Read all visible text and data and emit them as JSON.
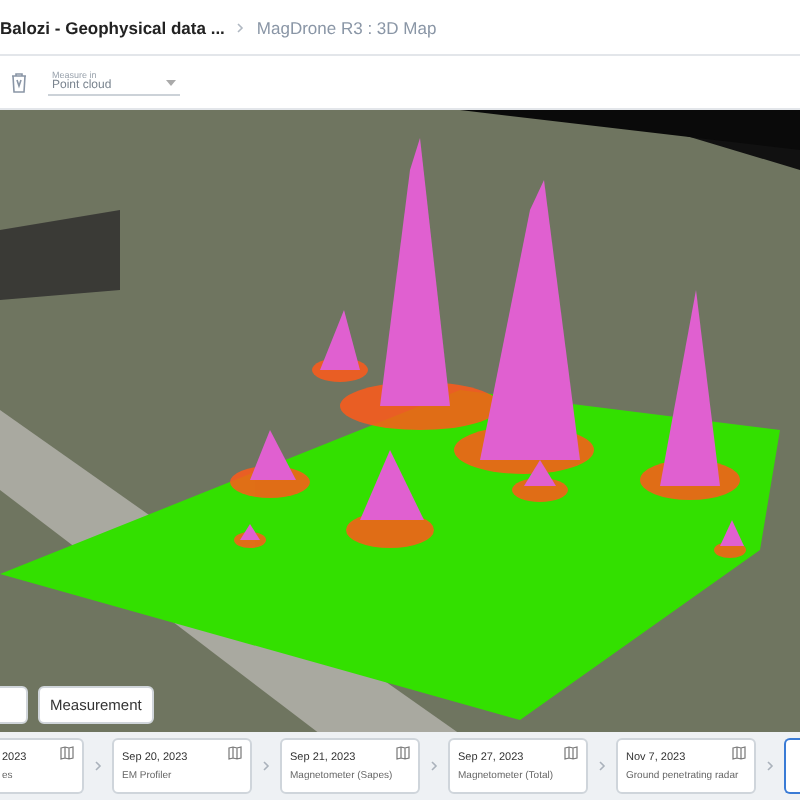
{
  "breadcrumb": [
    {
      "label": "Balozi - Geophysical data ...",
      "selected": false
    },
    {
      "label": "MagDrone R3 : 3D Map",
      "selected": true
    }
  ],
  "toolbar": {
    "dropdown": {
      "label": "Measure in",
      "value": "Point cloud"
    }
  },
  "map_controls": [
    {
      "kind": "button"
    },
    {
      "kind": "dropdown",
      "label": "Measurement"
    }
  ],
  "timeline": [
    {
      "kind": "partial",
      "date": "2023",
      "title": "es",
      "selected": false
    },
    {
      "date": "Sep 20, 2023",
      "title": "EM Profiler",
      "selected": false
    },
    {
      "date": "Sep 21, 2023",
      "title": "Magnetometer (Sapes)",
      "selected": false
    },
    {
      "date": "Sep 27, 2023",
      "title": "Magnetometer (Total)",
      "selected": false
    },
    {
      "date": "Nov 7, 2023",
      "title": "Ground penetrating radar",
      "selected": false
    },
    {
      "kind": "partial",
      "selected": true
    }
  ]
}
